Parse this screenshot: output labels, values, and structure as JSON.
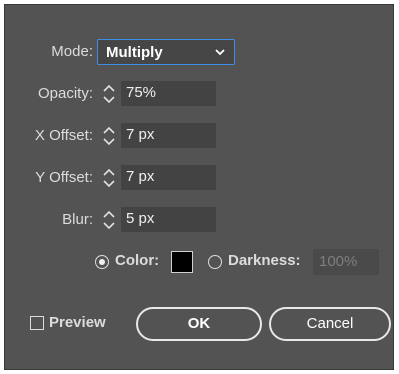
{
  "mode": {
    "label": "Mode:",
    "value": "Multiply"
  },
  "opacity": {
    "label": "Opacity:",
    "value": "75%"
  },
  "x_offset": {
    "label": "X Offset:",
    "value": "7 px"
  },
  "y_offset": {
    "label": "Y Offset:",
    "value": "7 px"
  },
  "blur": {
    "label": "Blur:",
    "value": "5 px"
  },
  "color_option": {
    "label": "Color:",
    "selected": true,
    "swatch": "#000000"
  },
  "darkness_option": {
    "label": "Darkness:",
    "selected": false,
    "value": "100%"
  },
  "preview": {
    "label": "Preview",
    "checked": false
  },
  "buttons": {
    "ok": "OK",
    "cancel": "Cancel"
  },
  "colors": {
    "dialog_bg": "#535353",
    "field_bg": "#434343",
    "focus": "#3d8ee8"
  },
  "icons": [
    "spin-up-down-icon",
    "chevron-down-icon"
  ]
}
